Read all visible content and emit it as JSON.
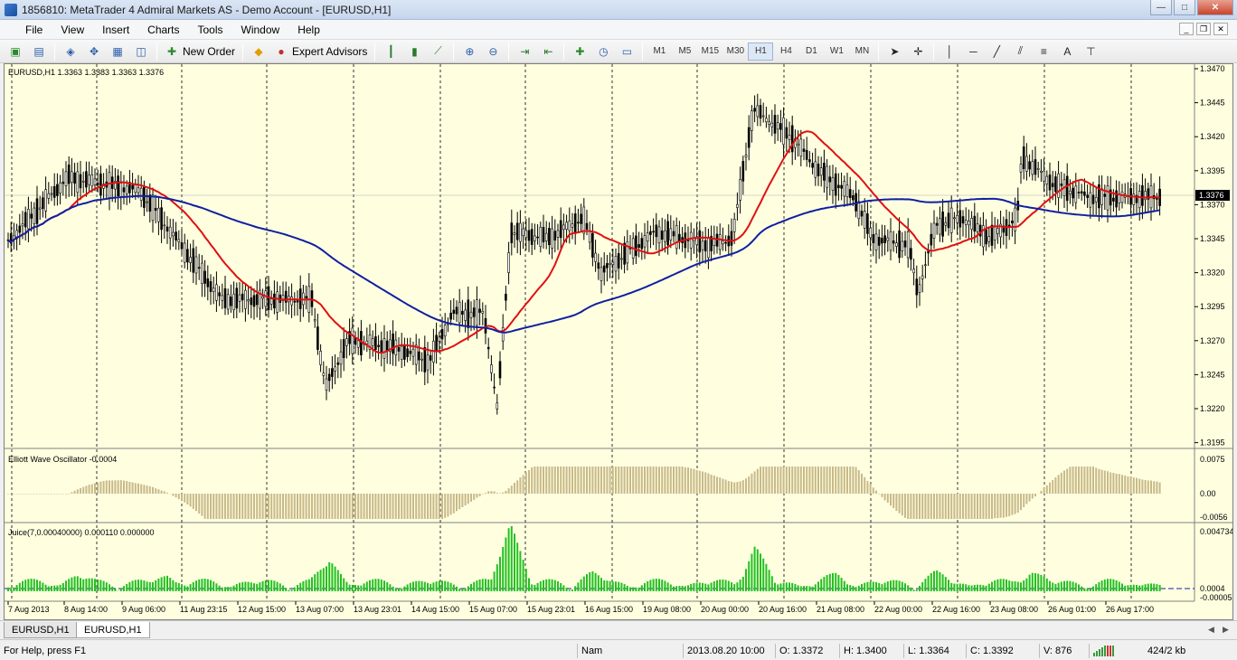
{
  "window": {
    "title": "1856810: MetaTrader 4 Admiral Markets AS - Demo Account - [EURUSD,H1]",
    "min_label": "—",
    "max_label": "□",
    "close_label": "✕"
  },
  "menu": [
    "File",
    "View",
    "Insert",
    "Charts",
    "Tools",
    "Window",
    "Help"
  ],
  "mdi_buttons": [
    "_",
    "❐",
    "✕"
  ],
  "toolbar": {
    "new_order_label": "New Order",
    "expert_advisors_label": "Expert Advisors",
    "timeframes": [
      "M1",
      "M5",
      "M15",
      "M30",
      "H1",
      "H4",
      "D1",
      "W1",
      "MN"
    ],
    "active_timeframe": "H1",
    "text_tool": "A"
  },
  "chart": {
    "header": "EURUSD,H1  1.3363 1.3383 1.3363 1.3376",
    "current_price": "1.3376",
    "price_axis": [
      "1.3470",
      "1.3445",
      "1.3420",
      "1.3395",
      "1.3370",
      "1.3345",
      "1.3320",
      "1.3295",
      "1.3270",
      "1.3245",
      "1.3220",
      "1.3195"
    ],
    "time_axis": [
      "7 Aug 2013",
      "8 Aug 14:00",
      "9 Aug 06:00",
      "11 Aug 23:15",
      "12 Aug 15:00",
      "13 Aug 07:00",
      "13 Aug 23:01",
      "14 Aug 15:00",
      "15 Aug 07:00",
      "15 Aug 23:01",
      "16 Aug 15:00",
      "19 Aug 08:00",
      "20 Aug 00:00",
      "20 Aug 16:00",
      "21 Aug 08:00",
      "22 Aug 00:00",
      "22 Aug 16:00",
      "23 Aug 08:00",
      "26 Aug 01:00",
      "26 Aug 17:00"
    ],
    "colors": {
      "background": "#ffffe0",
      "ma_fast": "#e01010",
      "ma_slow": "#1020a0",
      "candles": "#000000",
      "oscillator": "#c8b98a",
      "juice": "#22c022",
      "juice_level": "#1020a0"
    }
  },
  "oscillator": {
    "label": "Elliott Wave Oscillator -0.0004",
    "axis": [
      "0.0075",
      "0.00",
      "-0.0056"
    ]
  },
  "juice": {
    "label": "Juice(7,0.00040000) 0.000110 0.000000",
    "axis": [
      "0.004734",
      "0.0004",
      "-0.000055"
    ]
  },
  "tabs": [
    {
      "label": "EURUSD,H1",
      "active": false
    },
    {
      "label": "EURUSD,H1",
      "active": true
    }
  ],
  "status": {
    "help": "For Help, press F1",
    "profile": "Nam",
    "datetime": "2013.08.20 10:00",
    "open": "O: 1.3372",
    "high": "H: 1.3400",
    "low": "L: 1.3364",
    "close": "C: 1.3392",
    "volume": "V: 876",
    "traffic": "424/2 kb"
  }
}
